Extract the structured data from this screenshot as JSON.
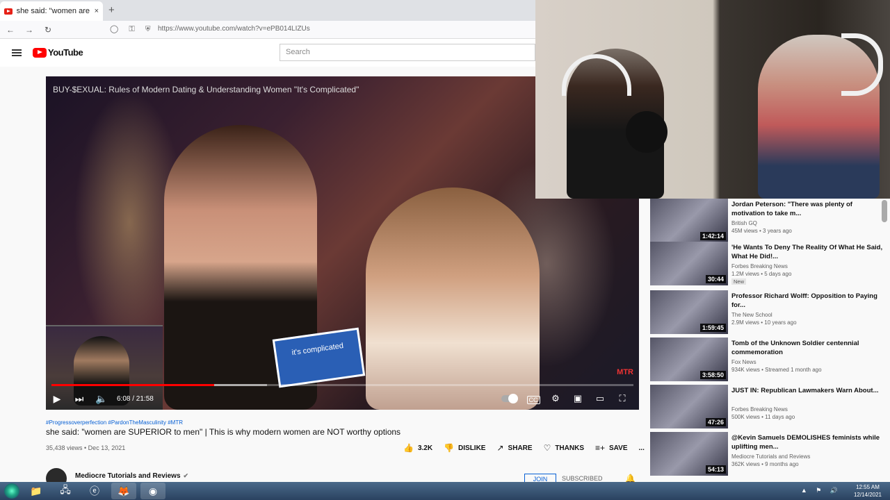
{
  "browser": {
    "tab_title": "she said: \"women are SUPERIOR",
    "tab_close": "×",
    "new_tab": "+",
    "url": "https://www.youtube.com/watch?v=ePB014LIZUs",
    "back": "←",
    "forward": "→",
    "reload": "↻"
  },
  "header": {
    "logo": "YouTube",
    "search_placeholder": "Search"
  },
  "video": {
    "overlay_title": "BUY-$EXUAL: Rules of Modern Dating & Understanding Women \"It's Complicated\"",
    "mic_flag": "it's complicated",
    "watermark": "MTR",
    "time": "6:08 / 21:58",
    "progress": 0.28,
    "buffered": 0.37
  },
  "info": {
    "hashtags": "#Progressoverperfection #PardonTheMasculinity #MTR",
    "title": "she said: \"women are SUPERIOR to men\" | This is why modern women are NOT worthy options",
    "meta": "35,438 views • Dec 13, 2021",
    "likes": "3.2K",
    "dislike": "DISLIKE",
    "share": "SHARE",
    "thanks": "THANKS",
    "save": "SAVE",
    "more": "..."
  },
  "channel": {
    "name": "Mediocre Tutorials and Reviews",
    "join": "JOIN",
    "subscribed": "SUBSCRIBED"
  },
  "recommendations": [
    {
      "title": "Jordan Peterson: \"There was plenty of motivation to take m...",
      "channel": "British GQ",
      "meta": "45M views • 3 years ago",
      "duration": "1:42:14",
      "badge": ""
    },
    {
      "title": "'He Wants To Deny The Reality Of What He Said, What He Did!...",
      "channel": "Forbes Breaking News",
      "meta": "1.2M views • 5 days ago",
      "duration": "30:44",
      "badge": "New"
    },
    {
      "title": "Professor Richard Wolff: Opposition to Paying for...",
      "channel": "The New School",
      "meta": "2.9M views • 10 years ago",
      "duration": "1:59:45",
      "badge": ""
    },
    {
      "title": "Tomb of the Unknown Soldier centennial commemoration",
      "channel": "Fox News",
      "meta": "934K views • Streamed 1 month ago",
      "duration": "3:58:50",
      "badge": ""
    },
    {
      "title": "JUST IN: Republican Lawmakers Warn About...",
      "channel": "Forbes Breaking News",
      "meta": "500K views • 11 days ago",
      "duration": "47:26",
      "badge": ""
    },
    {
      "title": "@Kevin Samuels DEMOLISHES feminists while uplifting men...",
      "channel": "Mediocre Tutorials and Reviews",
      "meta": "362K views • 9 months ago",
      "duration": "54:13",
      "badge": ""
    }
  ],
  "taskbar": {
    "time": "12:55 AM",
    "date": "12/14/2021"
  }
}
